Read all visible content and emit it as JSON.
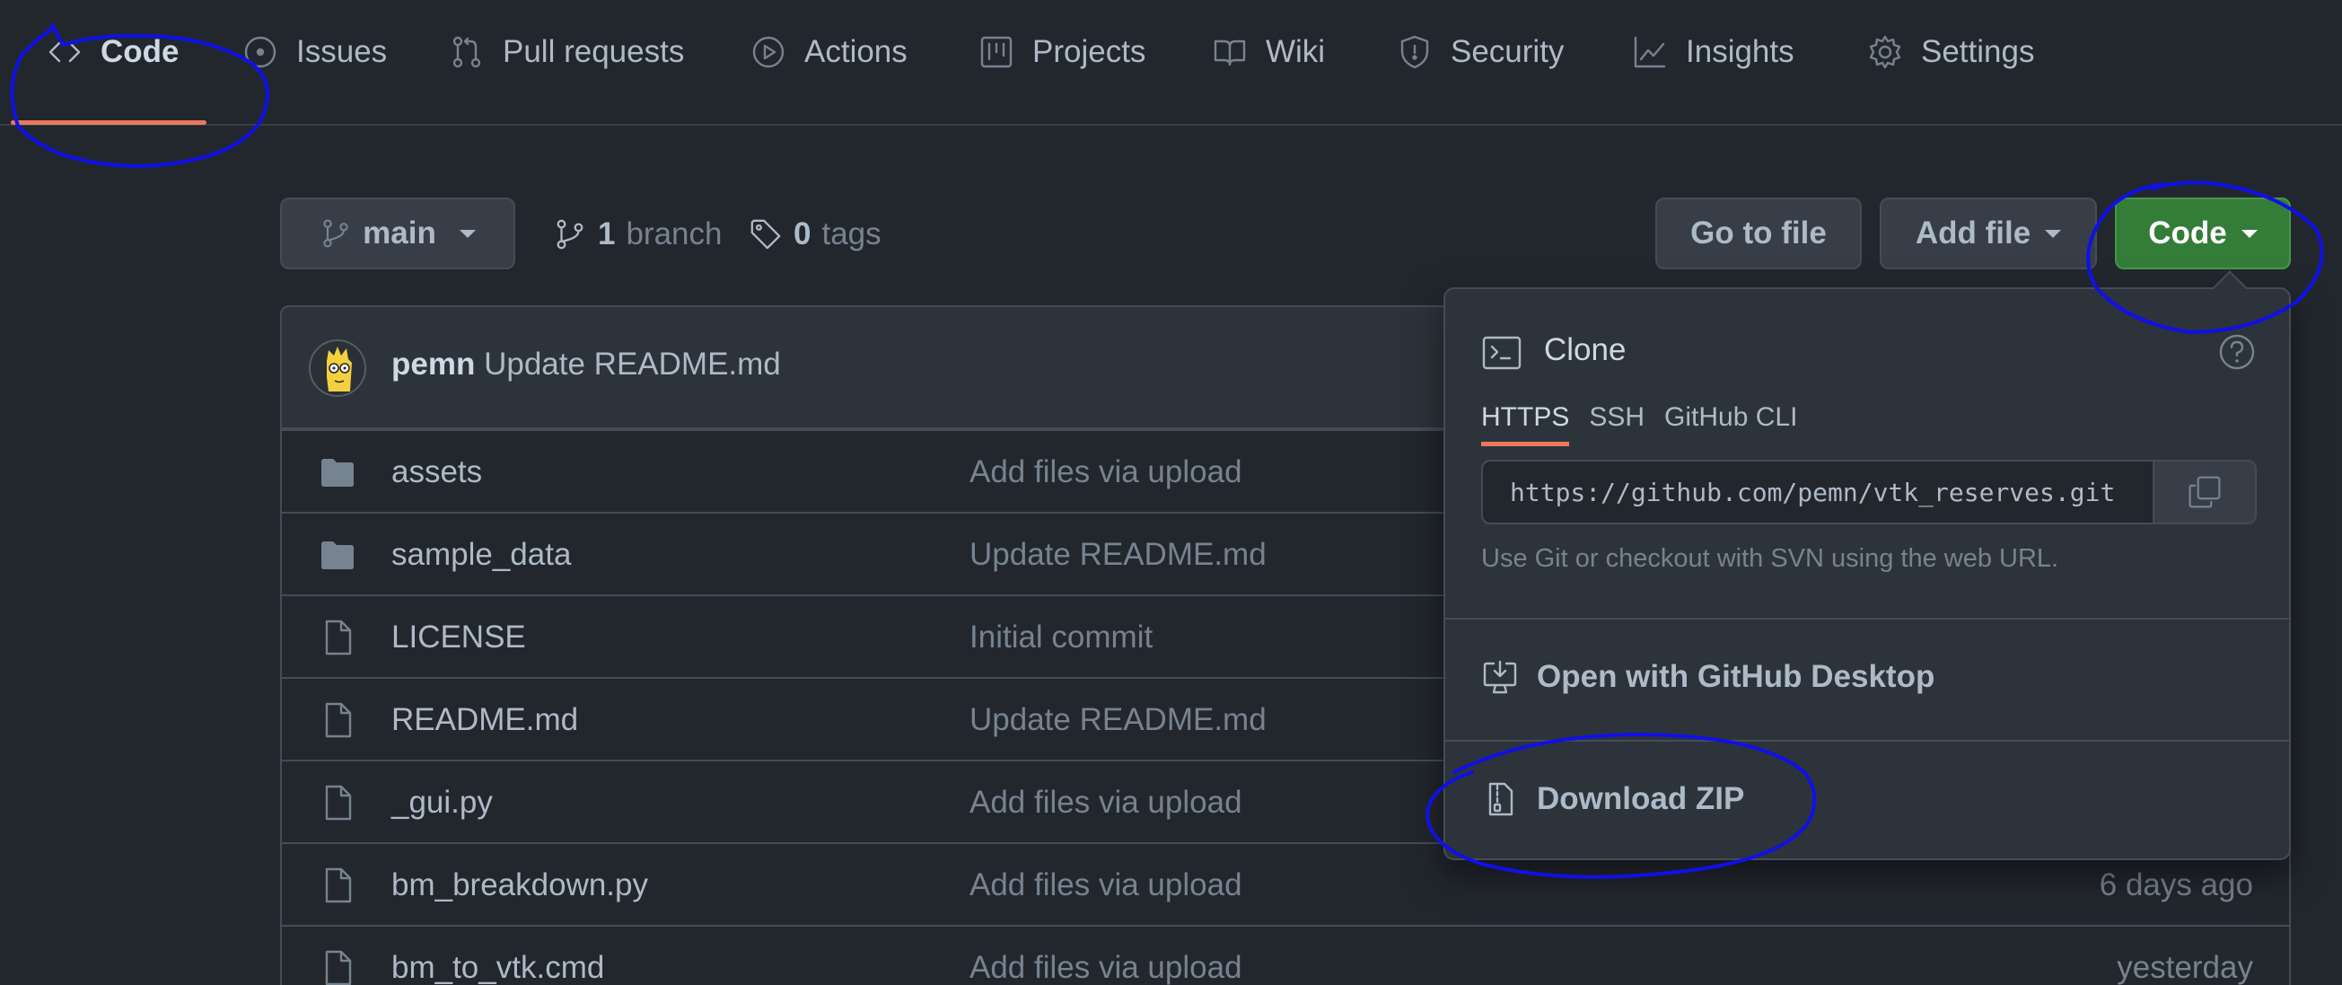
{
  "repo_nav": {
    "tabs": [
      {
        "label": "Code",
        "icon": "code-icon",
        "selected": true
      },
      {
        "label": "Issues",
        "icon": "issue-opened-icon"
      },
      {
        "label": "Pull requests",
        "icon": "git-pull-request-icon"
      },
      {
        "label": "Actions",
        "icon": "play-icon"
      },
      {
        "label": "Projects",
        "icon": "project-icon"
      },
      {
        "label": "Wiki",
        "icon": "book-icon"
      },
      {
        "label": "Security",
        "icon": "shield-icon"
      },
      {
        "label": "Insights",
        "icon": "graph-icon"
      },
      {
        "label": "Settings",
        "icon": "gear-icon"
      }
    ]
  },
  "toolbar": {
    "branch_select": "main",
    "branches_count": "1",
    "branches_label": "branch",
    "tags_count": "0",
    "tags_label": "tags",
    "go_to_file": "Go to file",
    "add_file": "Add file",
    "code_button": "Code"
  },
  "latest_commit": {
    "author": "pemn",
    "message": "Update README.md"
  },
  "files": [
    {
      "name": "assets",
      "type": "dir",
      "message": "Add files via upload",
      "age": ""
    },
    {
      "name": "sample_data",
      "type": "dir",
      "message": "Update README.md",
      "age": ""
    },
    {
      "name": "LICENSE",
      "type": "file",
      "message": "Initial commit",
      "age": ""
    },
    {
      "name": "README.md",
      "type": "file",
      "message": "Update README.md",
      "age": ""
    },
    {
      "name": "_gui.py",
      "type": "file",
      "message": "Add files via upload",
      "age": ""
    },
    {
      "name": "bm_breakdown.py",
      "type": "file",
      "message": "Add files via upload",
      "age": "6 days ago"
    },
    {
      "name": "bm_to_vtk.cmd",
      "type": "file",
      "message": "Add files via upload",
      "age": "yesterday"
    }
  ],
  "clone_panel": {
    "title": "Clone",
    "tabs": [
      "HTTPS",
      "SSH",
      "GitHub CLI"
    ],
    "active_tab": "HTTPS",
    "url": "https://github.com/pemn/vtk_reserves.git",
    "note": "Use Git or checkout with SVN using the web URL.",
    "open_desktop": "Open with GitHub Desktop",
    "download_zip": "Download ZIP"
  },
  "colors": {
    "background": "#22272e",
    "accent_underline": "#ec775c",
    "code_button_green": "#347d39",
    "annotation_blue": "#1010e8"
  }
}
